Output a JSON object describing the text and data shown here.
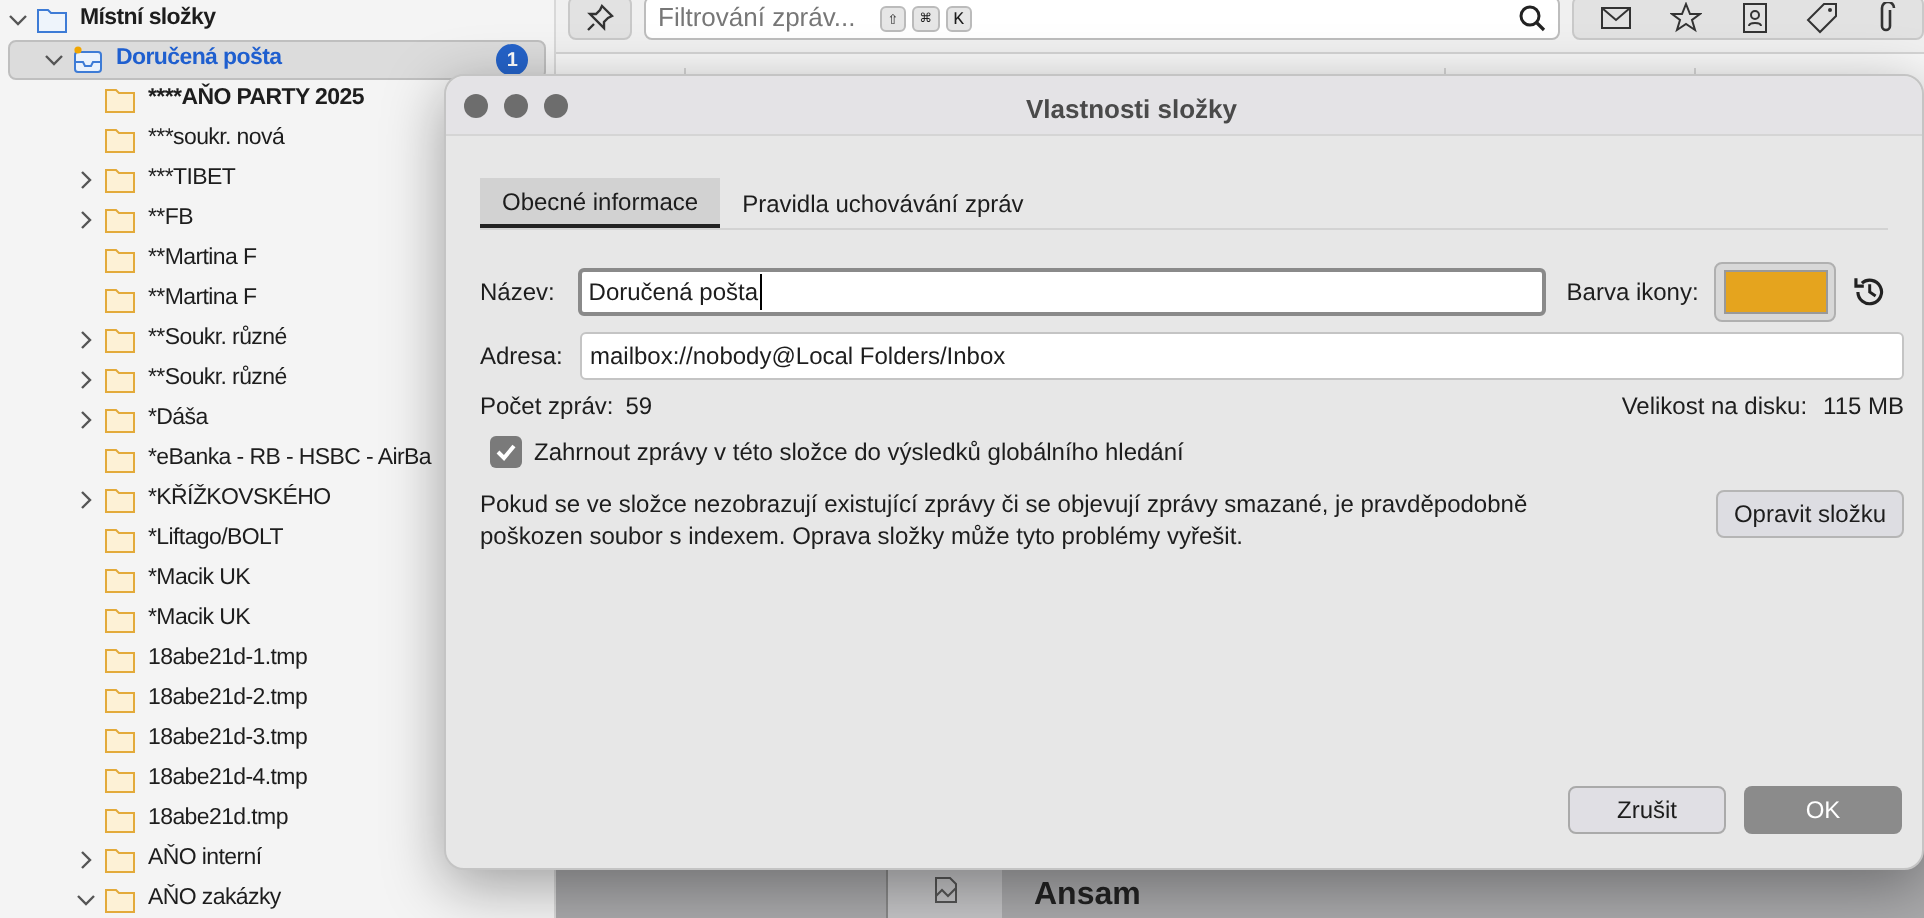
{
  "sidebar": {
    "items": [
      {
        "label": "Místní složky",
        "expanded": true,
        "selected": false,
        "children": [
          {
            "label": "Doručená pošta",
            "expanded": true,
            "selected": true,
            "unread_count": "1",
            "children": [
              {
                "label": "****AŇO PARTY 2025",
                "unread": true,
                "selected": false
              },
              {
                "label": "***soukr. nová",
                "unread": false,
                "selected": false
              },
              {
                "label": "***TIBET",
                "expanded": false,
                "unread": false,
                "selected": false
              },
              {
                "label": "**FB",
                "expanded": false,
                "unread": false,
                "selected": false
              },
              {
                "label": "**Martina F",
                "unread": false,
                "selected": false
              },
              {
                "label": "**Martina F",
                "unread": false,
                "selected": false
              },
              {
                "label": "**Soukr. různé",
                "expanded": false,
                "unread": false,
                "selected": false
              },
              {
                "label": "**Soukr. různé",
                "expanded": false,
                "unread": false,
                "selected": false
              },
              {
                "label": "*Dáša",
                "expanded": false,
                "unread": false,
                "selected": false
              },
              {
                "label": "*eBanka - RB - HSBC - AirBa",
                "unread": false,
                "selected": false
              },
              {
                "label": "*KŘÍŽKOVSKÉHO",
                "expanded": false,
                "unread": false,
                "selected": false
              },
              {
                "label": "*Liftago/BOLT",
                "unread": false,
                "selected": false
              },
              {
                "label": "*Macik UK",
                "unread": false,
                "selected": false
              },
              {
                "label": "*Macik UK",
                "unread": false,
                "selected": false
              },
              {
                "label": "18abe21d-1.tmp",
                "unread": false,
                "selected": false
              },
              {
                "label": "18abe21d-2.tmp",
                "unread": false,
                "selected": false
              },
              {
                "label": "18abe21d-3.tmp",
                "unread": false,
                "selected": false
              },
              {
                "label": "18abe21d-4.tmp",
                "unread": false,
                "selected": false
              },
              {
                "label": "18abe21d.tmp",
                "unread": false,
                "selected": false
              },
              {
                "label": "AŇO interní",
                "expanded": false,
                "unread": false,
                "selected": false
              },
              {
                "label": "AŇO zakázky",
                "expanded": true,
                "unread": false,
                "selected": false
              }
            ]
          }
        ]
      }
    ]
  },
  "toolbar": {
    "search": {
      "placeholder": "Filtrování zpráv...",
      "shortcut_keys": [
        "⇧",
        "⌘",
        "K"
      ]
    }
  },
  "message_list": {
    "rows": [
      {
        "correspondent": "Ansam"
      }
    ]
  },
  "dialog": {
    "title": "Vlastnosti složky",
    "tabs": [
      {
        "label": "Obecné informace",
        "selected": true
      },
      {
        "label": "Pravidla uchovávání zpráv",
        "selected": false
      }
    ],
    "name_label": "Název:",
    "name_value": "Doručená pošta",
    "icon_color_label": "Barva ikony:",
    "icon_color_swatch": {
      "color": "#e5a41e"
    },
    "address_label": "Adresa:",
    "address_value": "mailbox://nobody@Local Folders/Inbox",
    "count_label": "Počet zpráv:",
    "count_value": "59",
    "size_label": "Velikost na disku:",
    "size_value": "115 MB",
    "include_in_search": {
      "label": "Zahrnout zprávy v této složce do výsledků globálního hledání",
      "checked": true
    },
    "repair_text": "Pokud se ve složce nezobrazují existující zprávy či se objevují zprávy smazané, je pravděpodobně poškozen soubor s indexem. Oprava složky může tyto problémy vyřešit.",
    "repair_button": "Opravit složku",
    "cancel_button": "Zrušit",
    "ok_button": "OK"
  }
}
